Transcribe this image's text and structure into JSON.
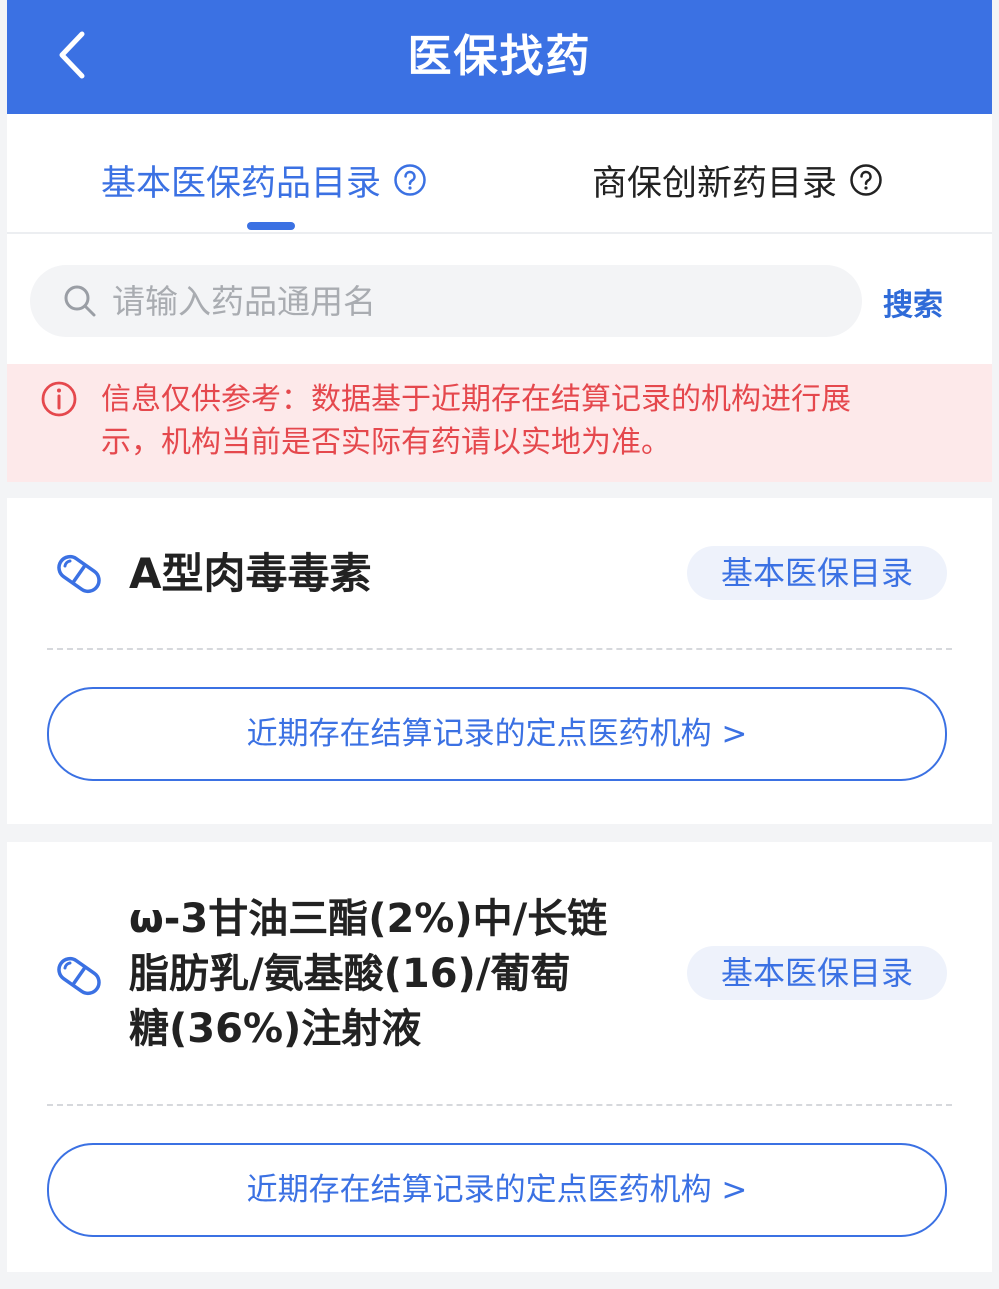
{
  "header": {
    "title": "医保找药",
    "back_icon": "chevron-left-icon"
  },
  "tabs": [
    {
      "label": "基本医保药品目录",
      "active": true,
      "icon": "question-circle-icon"
    },
    {
      "label": "商保创新药目录",
      "active": false,
      "icon": "question-circle-icon"
    }
  ],
  "search": {
    "placeholder": "请输入药品通用名",
    "value": "",
    "button_label": "搜索",
    "icon": "search-icon"
  },
  "notice": {
    "icon": "info-circle-icon",
    "text_line1": "信息仅供参考：数据基于近期存在结算记录的机构进行展",
    "text_line2": "示，机构当前是否实际有药请以实地为准。"
  },
  "drugs": [
    {
      "name": "A型肉毒毒素",
      "tag": "基本医保目录",
      "button_label": "近期存在结算记录的定点医药机构 >",
      "icon": "pill-icon"
    },
    {
      "name_line1": "ω-3甘油三酯(2%)中/长链",
      "name_line2": "脂肪乳/氨基酸(16)/葡萄",
      "name_line3": "糖(36%)注射液",
      "tag": "基本医保目录",
      "button_label": "近期存在结算记录的定点医药机构 >",
      "icon": "pill-icon"
    }
  ],
  "colors": {
    "primary": "#3b71e3",
    "notice_bg": "#fde9ea",
    "notice_text": "#e5484d",
    "tag_bg": "#eef2fb"
  }
}
